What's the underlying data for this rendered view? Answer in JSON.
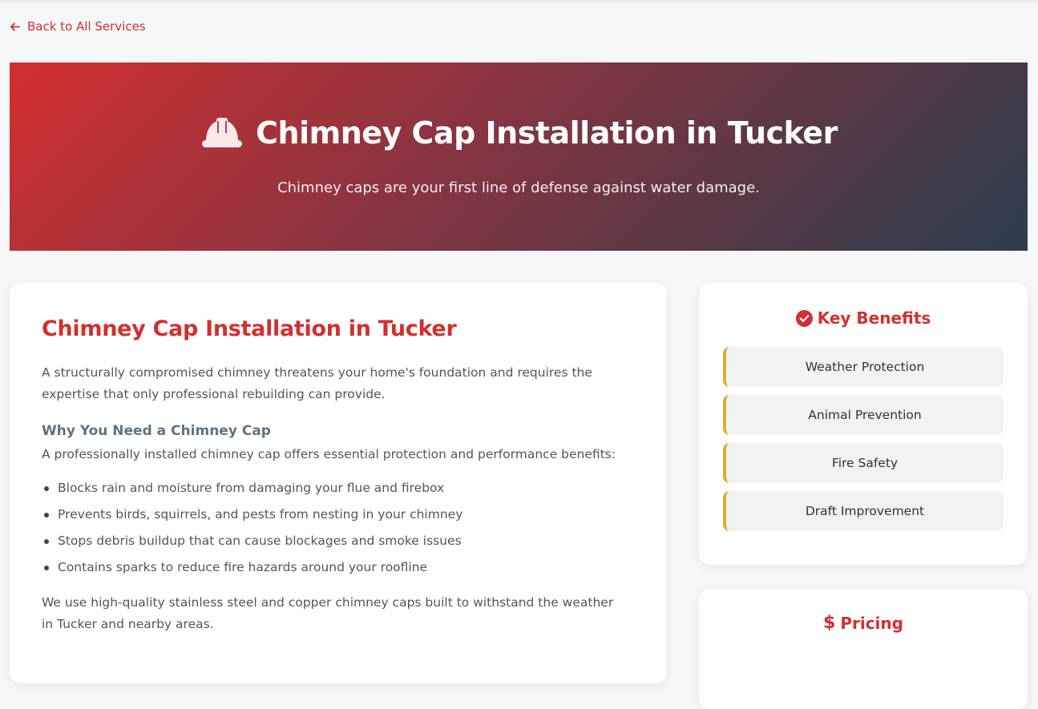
{
  "nav": {
    "back_label": "Back to All Services"
  },
  "hero": {
    "icon": "hard-hat-icon",
    "title": "Chimney Cap Installation in Tucker",
    "subtitle": "Chimney caps are your first line of defense against water damage."
  },
  "content": {
    "heading": "Chimney Cap Installation in Tucker",
    "intro": "A structurally compromised chimney threatens your home's foundation and requires the expertise that only professional rebuilding can provide.",
    "subheading": "Why You Need a Chimney Cap",
    "lead": "A professionally installed chimney cap offers essential protection and performance benefits:",
    "bullets": [
      "Blocks rain and moisture from damaging your flue and firebox",
      "Prevents birds, squirrels, and pests from nesting in your chimney",
      "Stops debris buildup that can cause blockages and smoke issues",
      "Contains sparks to reduce fire hazards around your roofline"
    ],
    "closing": "We use high-quality stainless steel and copper chimney caps built to withstand the weather in Tucker and nearby areas."
  },
  "benefits": {
    "icon": "check-circle-icon",
    "title": "Key Benefits",
    "items": [
      "Weather Protection",
      "Animal Prevention",
      "Fire Safety",
      "Draft Improvement"
    ]
  },
  "pricing": {
    "icon": "dollar-icon",
    "icon_glyph": "$",
    "title": "Pricing"
  },
  "colors": {
    "accent": "#d32f2f",
    "hero_gradient_end": "#2c3e50",
    "benefit_border": "#dcae32",
    "subheading": "#5f7283"
  }
}
